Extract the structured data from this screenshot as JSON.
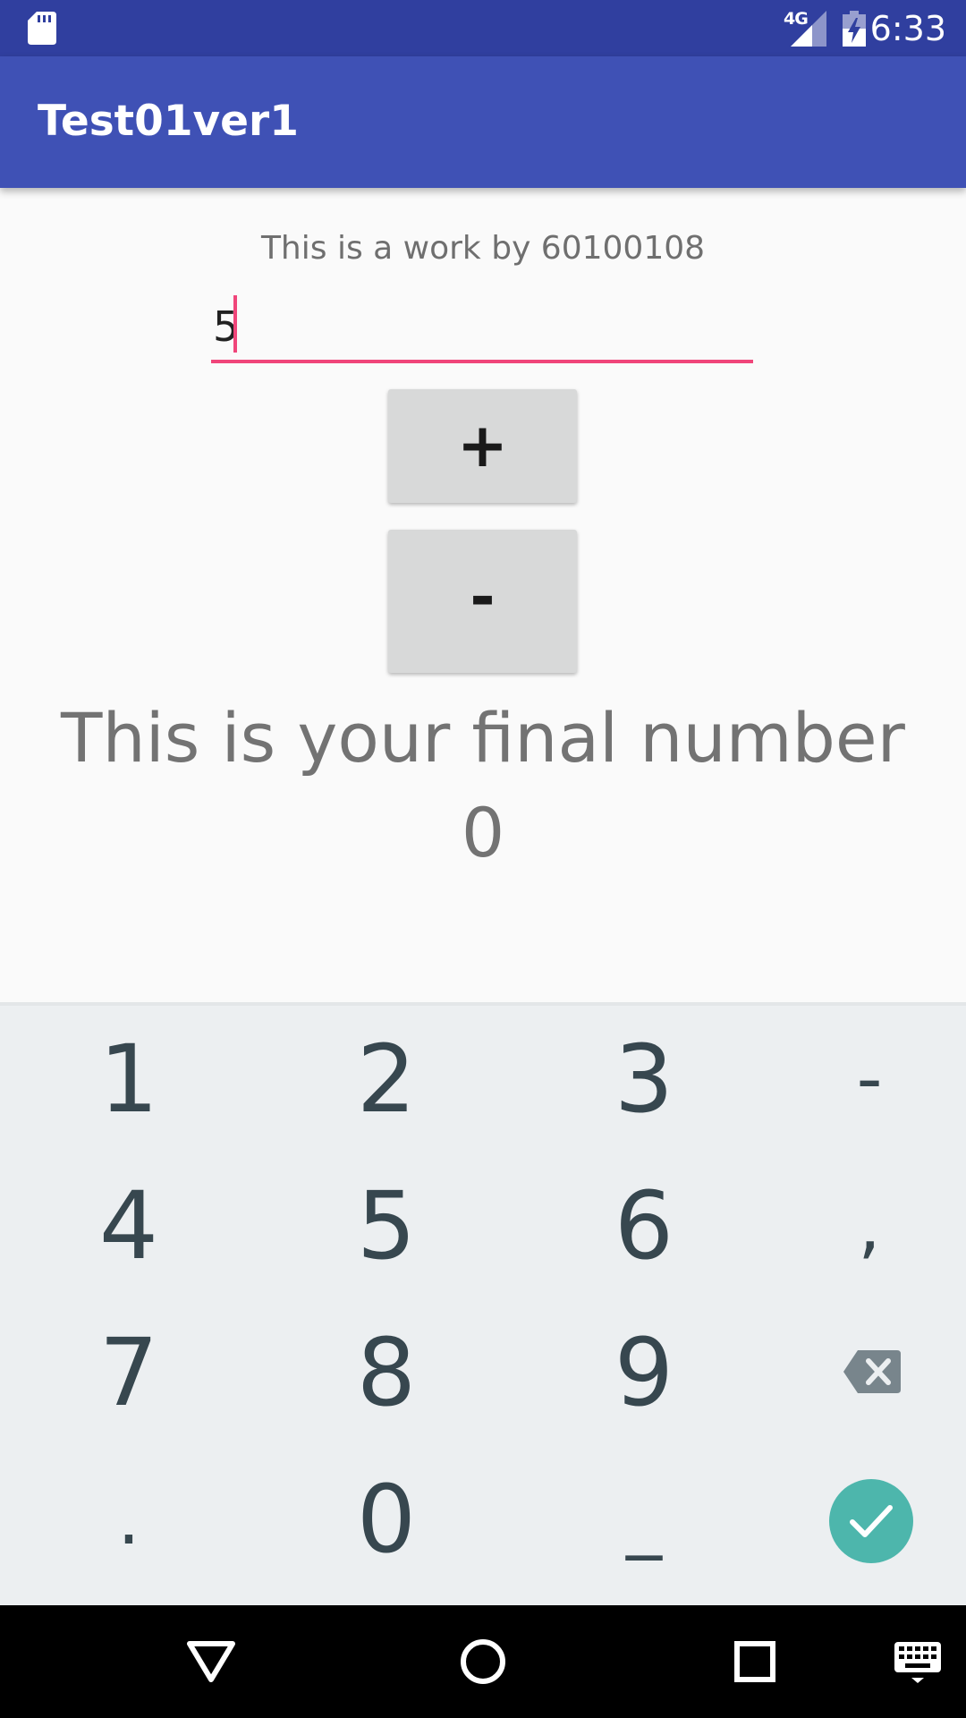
{
  "status_bar": {
    "time": "6:33",
    "network_type": "4G",
    "icons": [
      "sd-card-icon",
      "signal-icon",
      "battery-charging-icon"
    ]
  },
  "app_bar": {
    "title": "Test01ver1"
  },
  "content": {
    "author_text": "This is a work by 60100108",
    "input_value": "5",
    "plus_label": "+",
    "minus_label": "-",
    "final_label": "This is your final number",
    "final_value": "0"
  },
  "keyboard": {
    "rows": [
      [
        "1",
        "2",
        "3",
        "-"
      ],
      [
        "4",
        "5",
        "6",
        ","
      ],
      [
        "7",
        "8",
        "9",
        "backspace-icon"
      ],
      [
        ".",
        "0",
        "_",
        "done-icon"
      ]
    ],
    "accent_color": "#4db6ac"
  },
  "nav_bar": {
    "icons": [
      "back-icon",
      "home-icon",
      "recents-icon",
      "keyboard-switch-icon"
    ]
  },
  "colors": {
    "status_bar": "#303f9f",
    "app_bar": "#3f51b5",
    "input_accent": "#f0457a",
    "key_text": "#37474f"
  }
}
